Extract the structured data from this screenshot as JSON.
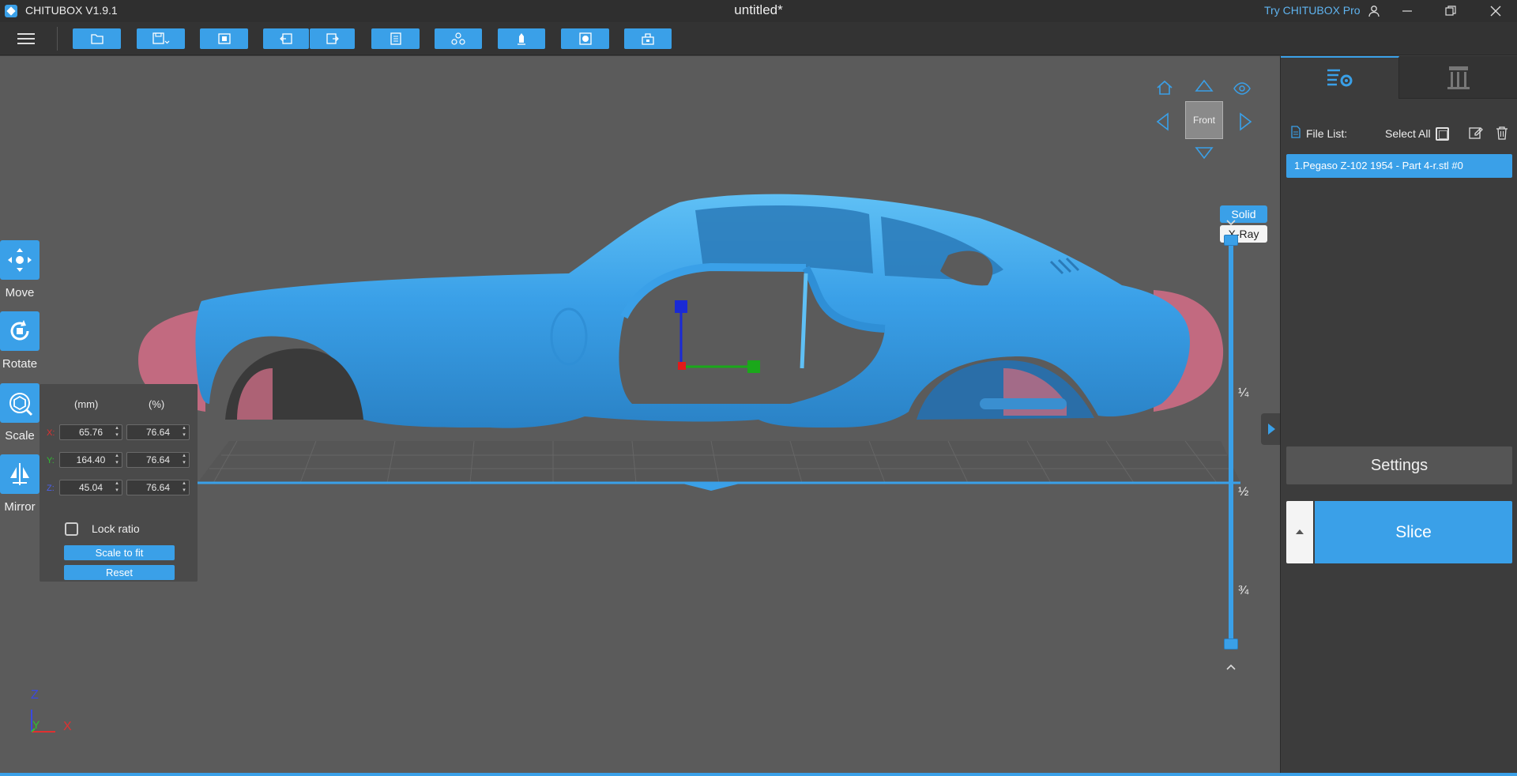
{
  "app": {
    "name": "CHITUBOX V1.9.1",
    "document_title": "untitled*",
    "try_pro": "Try CHITUBOX Pro"
  },
  "window_controls": [
    "user-icon",
    "minimize-icon",
    "restore-icon",
    "close-icon"
  ],
  "toolbar": {
    "icons": [
      "menu-icon",
      "open-file-icon",
      "save-icon",
      "screenshot-icon",
      "undo-icon",
      "redo-icon",
      "notes-icon",
      "layout-icon",
      "support-icon",
      "hollow-icon",
      "dig-hole-icon"
    ]
  },
  "tools": {
    "move": "Move",
    "rotate": "Rotate",
    "scale": "Scale",
    "mirror": "Mirror"
  },
  "scale_panel": {
    "unit_mm": "(mm)",
    "unit_pct": "(%)",
    "x_label": "X:",
    "y_label": "Y:",
    "z_label": "Z:",
    "x_mm": "65.76",
    "y_mm": "164.40",
    "z_mm": "45.04",
    "x_pct": "76.64",
    "y_pct": "76.64",
    "z_pct": "76.64",
    "lock_ratio": "Lock ratio",
    "lock_ratio_checked": false,
    "scale_to_fit": "Scale to fit",
    "reset": "Reset"
  },
  "view_cube": {
    "front": "Front",
    "solid": "Solid",
    "xray": "X-Ray"
  },
  "layer_slider": {
    "quarter": "¼",
    "half": "½",
    "three_quarter": "¾"
  },
  "axis_indicator": {
    "z": "Z",
    "y": "Y",
    "x": "X"
  },
  "file_panel": {
    "file_list_label": "File List:",
    "select_all": "Select All",
    "files": [
      "1.Pegaso Z-102 1954 - Part 4-r.stl #0"
    ]
  },
  "actions": {
    "settings": "Settings",
    "slice": "Slice"
  },
  "colors": {
    "accent": "#3aa0e8",
    "model_blue": "#3a9fe6",
    "model_pink": "#c26a80",
    "viewport_bg": "#5b5b5b",
    "panel_bg": "#3c3c3c"
  }
}
